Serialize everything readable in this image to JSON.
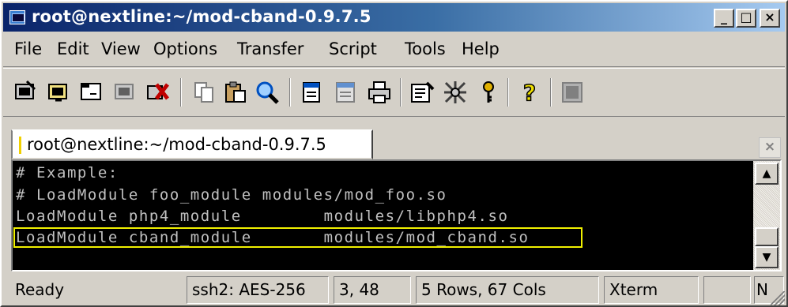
{
  "window": {
    "title": "root@nextline:~/mod-cband-0.9.7.5",
    "controls": [
      "_",
      "□",
      "×"
    ]
  },
  "menu": [
    {
      "label": "File"
    },
    {
      "label": "Edit"
    },
    {
      "label": "View"
    },
    {
      "label": "Options"
    },
    {
      "label": "Transfer"
    },
    {
      "label": "Script"
    },
    {
      "label": "Tools"
    },
    {
      "label": "Help"
    }
  ],
  "toolbar": [
    {
      "name": "connect-icon"
    },
    {
      "name": "quick-connect-icon"
    },
    {
      "name": "connect-in-tab-icon"
    },
    {
      "name": "reconnect-icon"
    },
    {
      "name": "disconnect-icon"
    },
    {
      "name": "copy-icon"
    },
    {
      "name": "paste-icon"
    },
    {
      "name": "find-icon"
    },
    {
      "name": "print-setup-icon"
    },
    {
      "name": "print-screen-icon"
    },
    {
      "name": "print-icon"
    },
    {
      "name": "session-options-icon"
    },
    {
      "name": "global-options-icon"
    },
    {
      "name": "keymap-icon"
    },
    {
      "name": "help-icon"
    },
    {
      "name": "sftp-icon"
    }
  ],
  "tab": {
    "label": "root@nextline:~/mod-cband-0.9.7.5",
    "close": "×"
  },
  "terminal": {
    "lines": [
      "# Example:",
      "# LoadModule foo_module modules/mod_foo.so",
      "LoadModule php4_module        modules/libphp4.so",
      "LoadModule cband_module       modules/mod_cband.so"
    ],
    "highlighted_line": 4,
    "background": "#000000",
    "foreground": "#c0c0c0",
    "highlight_color": "#f0f000"
  },
  "scrollbar": {
    "up": "▲",
    "down": "▼"
  },
  "status": {
    "state": "Ready",
    "cipher": "ssh2: AES-256",
    "cursor": "3,  48",
    "size": "5 Rows,  67 Cols",
    "emulation": "Xterm",
    "blank": "",
    "mode": "N"
  }
}
